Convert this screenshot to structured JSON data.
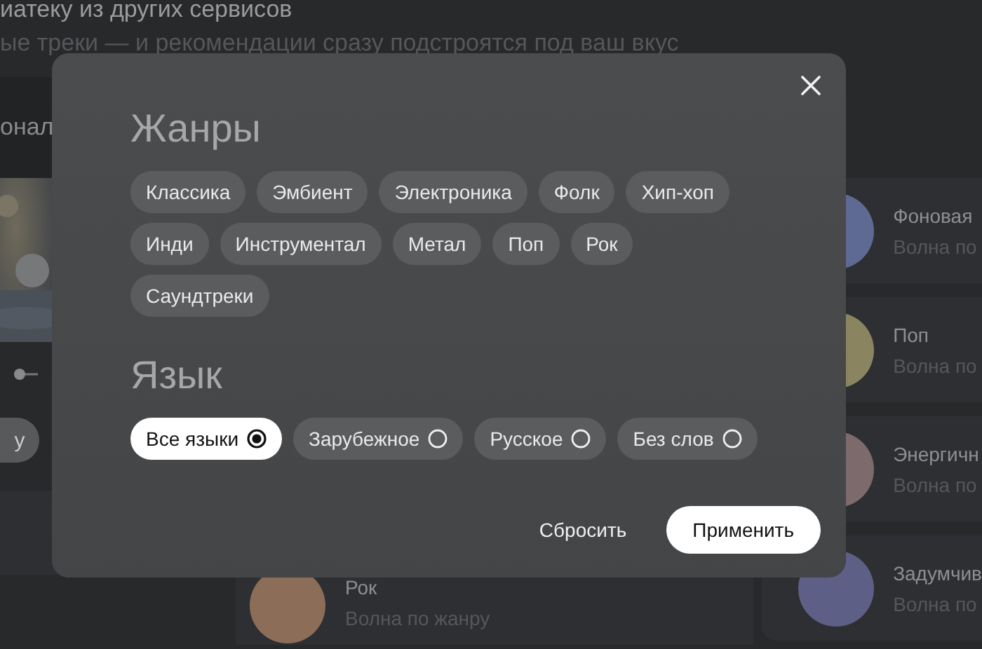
{
  "header": {
    "title": "иатеку из других сервисов",
    "subtitle": "ые треки — и рекомендации сразу подстроятся под ваш вкус"
  },
  "left_panel": {
    "heading": "онал",
    "button": "у"
  },
  "wave_cards": [
    {
      "title": "Фоновая",
      "subtitle": "Волна по",
      "color": "#5f6a94"
    },
    {
      "title": "Поп",
      "subtitle": "Волна по",
      "color": "#8a8560"
    },
    {
      "title": "Энергичн",
      "subtitle": "Волна по",
      "color": "#7d6a6c"
    },
    {
      "title": "Задумчив",
      "subtitle": "Волна по",
      "color": "#5d5f86"
    }
  ],
  "bottom_card": {
    "title": "Рок",
    "subtitle": "Волна по жанру",
    "color": "#8c6d58"
  },
  "dialog": {
    "genres_title": "Жанры",
    "genres": [
      {
        "label": "Классика",
        "selected": false
      },
      {
        "label": "Эмбиент",
        "selected": false
      },
      {
        "label": "Электроника",
        "selected": false
      },
      {
        "label": "Фолк",
        "selected": false
      },
      {
        "label": "Хип-хоп",
        "selected": false
      },
      {
        "label": "Инди",
        "selected": false
      },
      {
        "label": "Инструментал",
        "selected": false
      },
      {
        "label": "Метал",
        "selected": false
      },
      {
        "label": "Поп",
        "selected": false
      },
      {
        "label": "Рок",
        "selected": false
      },
      {
        "label": "Саундтреки",
        "selected": false
      }
    ],
    "language_title": "Язык",
    "languages": [
      {
        "label": "Все языки",
        "selected": true
      },
      {
        "label": "Зарубежное",
        "selected": false
      },
      {
        "label": "Русское",
        "selected": false
      },
      {
        "label": "Без слов",
        "selected": false
      }
    ],
    "reset_button": "Сбросить",
    "apply_button": "Применить"
  }
}
